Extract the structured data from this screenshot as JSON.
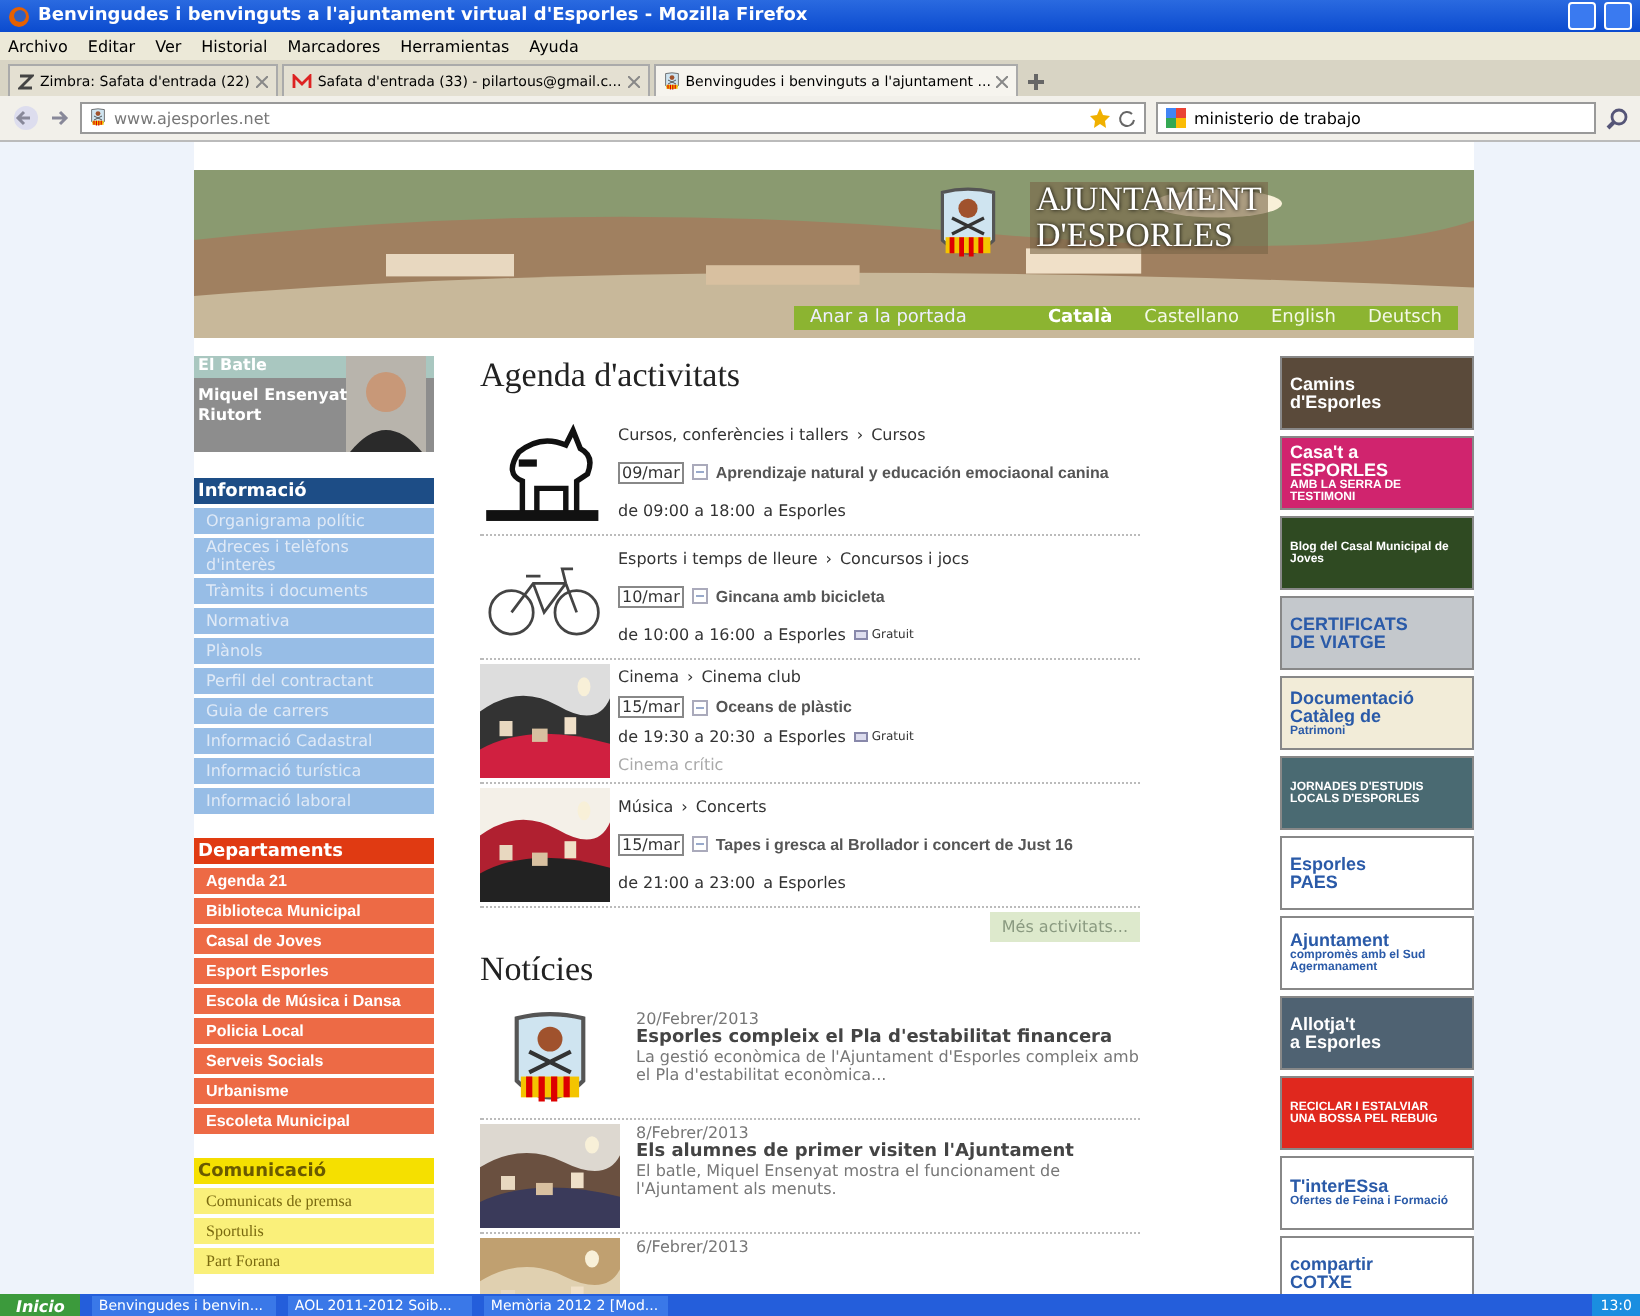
{
  "window": {
    "title": "Benvingudes i benvinguts a l'ajuntament virtual d'Esporles - Mozilla Firefox"
  },
  "menu": [
    "Archivo",
    "Editar",
    "Ver",
    "Historial",
    "Marcadores",
    "Herramientas",
    "Ayuda"
  ],
  "tabs": [
    {
      "label": "Zimbra: Safata d'entrada (22)",
      "kind": "zimbra",
      "selected": false
    },
    {
      "label": "Safata d'entrada (33) - pilartous@gmail.c...",
      "kind": "mail",
      "selected": false
    },
    {
      "label": "Benvingudes i benvinguts a l'ajuntament ...",
      "kind": "site",
      "selected": true
    }
  ],
  "address": "www.ajesporles.net",
  "search": "ministerio de trabajo",
  "header": {
    "title_lines": [
      "AJUNTAMENT",
      "D'ESPORLES"
    ],
    "home_link": "Anar a la portada",
    "languages": [
      {
        "label": "Català",
        "selected": true
      },
      {
        "label": "Castellano",
        "selected": false
      },
      {
        "label": "English",
        "selected": false
      },
      {
        "label": "Deutsch",
        "selected": false
      }
    ]
  },
  "mayor": {
    "label": "El Batle",
    "name": "Miquel Ensenyat Riutort"
  },
  "sidebar": [
    {
      "title": "Informació",
      "kind": "info",
      "items": [
        "Organigrama polític",
        "Adreces i telèfons d'interès",
        "Tràmits i documents",
        "Normativa",
        "Plànols",
        "Perfil del contractant",
        "Guia de carrers",
        "Informació Cadastral",
        "Informació turística",
        "Informació laboral"
      ]
    },
    {
      "title": "Departaments",
      "kind": "dept",
      "items": [
        "Agenda 21",
        "Biblioteca Municipal",
        "Casal de Joves",
        "Esport Esporles",
        "Escola de Música i Dansa",
        "Policia Local",
        "Serveis Socials",
        "Urbanisme",
        "Escoleta Municipal"
      ]
    },
    {
      "title": "Comunicació",
      "kind": "comm",
      "items": [
        "Comunicats de premsa",
        "Sportulis",
        "Part Forana"
      ]
    }
  ],
  "agenda": {
    "title": "Agenda d'activitats",
    "more": "Més activitats...",
    "separator": "›",
    "events": [
      {
        "kind": "dog",
        "category": "Cursos, conferències i tallers",
        "subcategory": "Cursos",
        "date": "09/mar",
        "title": "Aprendizaje natural y educación emociaonal canina",
        "time": "de 09:00 a 18:00",
        "place": "a Esporles"
      },
      {
        "kind": "bicycle",
        "category": "Esports i temps de lleure",
        "subcategory": "Concursos i jocs",
        "date": "10/mar",
        "title": "Gincana amb bicicleta",
        "time": "de 10:00 a 16:00",
        "place": "a Esporles",
        "price": "Gratuit"
      },
      {
        "kind": "picture",
        "category": "Cinema",
        "subcategory": "Cinema club",
        "date": "15/mar",
        "title": "Oceans de plàstic",
        "time": "de 19:30 a 20:30",
        "place": "a Esporles",
        "price": "Gratuit",
        "note": "Cinema crític"
      },
      {
        "kind": "picture",
        "category": "Música",
        "subcategory": "Concerts",
        "date": "15/mar",
        "title": "Tapes i gresca al Brollador i concert de Just 16",
        "time": "de 21:00 a 23:00",
        "place": "a Esporles"
      }
    ]
  },
  "news": {
    "title": "Notícies",
    "items": [
      {
        "kind": "arms",
        "date": "20/Febrer/2013",
        "headline": "Esporles compleix el Pla d'estabilitat financera",
        "summary": "La gestió econòmica de l'Ajuntament d'Esporles compleix amb el Pla d'estabilitat econòmica..."
      },
      {
        "kind": "picture",
        "date": "8/Febrer/2013",
        "headline": "Els alumnes de primer visiten l'Ajuntament",
        "summary": "El batle, Miquel Ensenyat mostra el funcionament de l'Ajuntament als menuts."
      },
      {
        "kind": "picture",
        "date": "6/Febrer/2013"
      }
    ]
  },
  "banners": [
    {
      "color": "#5a4a3a",
      "lines": [
        "Camins",
        "d'Esporles"
      ]
    },
    {
      "color": "#d0246e",
      "lines": [
        "Casa't a",
        "ESPORLES",
        "AMB LA SERRA DE TESTIMONI"
      ]
    },
    {
      "color": "#2f4a22",
      "lines": [
        "Blog del Casal Municipal de Joves"
      ]
    },
    {
      "color": "#c4c8cc",
      "lines": [
        "CERTIFICATS",
        "DE VIATGE"
      ]
    },
    {
      "color": "#f2ecd8",
      "lines": [
        "Documentació",
        "Catàleg de",
        "Patrimoni"
      ]
    },
    {
      "color": "#4a6a72",
      "lines": [
        "JORNADES D'ESTUDIS",
        "LOCALS D'ESPORLES"
      ]
    },
    {
      "color": "#ffffff",
      "lines": [
        "Esporles",
        "PAES"
      ]
    },
    {
      "color": "#ffffff",
      "lines": [
        "Ajuntament",
        "compromès amb el Sud",
        "Agermanament"
      ]
    },
    {
      "color": "#4f6272",
      "lines": [
        "Allotja't",
        "a Esporles"
      ]
    },
    {
      "color": "#e0281e",
      "lines": [
        "RECICLAR I ESTALVIAR",
        "UNA BOSSA PEL REBUIG"
      ]
    },
    {
      "color": "#ffffff",
      "lines": [
        "T'interESsa",
        "Ofertes de Feina i Formació"
      ]
    },
    {
      "color": "#ffffff",
      "lines": [
        "compartir",
        "COTXE"
      ]
    }
  ],
  "taskbar": {
    "start": "Inicio",
    "items": [
      "Benvingudes i benvin...",
      "AOL 2011-2012 Soib...",
      "Memòria 2012 2 [Mod..."
    ],
    "clock": "13:0"
  }
}
